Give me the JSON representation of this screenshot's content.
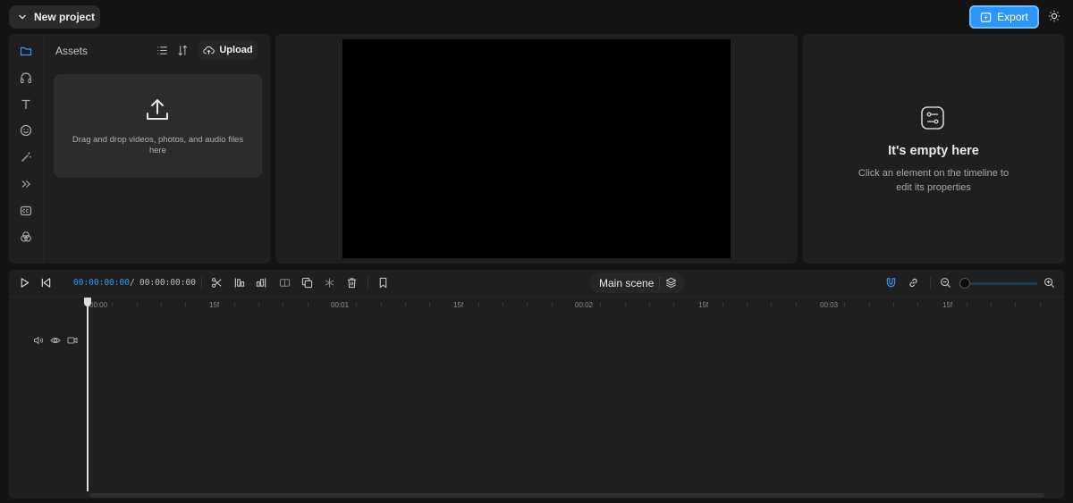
{
  "header": {
    "project_label": "New project",
    "export_label": "Export",
    "icons": [
      "chevron-down-icon",
      "export-icon",
      "sun-icon"
    ]
  },
  "assets_panel": {
    "title": "Assets",
    "upload_label": "Upload",
    "dropzone_text": "Drag and drop videos, photos, and audio files here",
    "rail_icons": [
      "folder-icon",
      "headphones-icon",
      "text-icon",
      "sticker-icon",
      "magic-wand-icon",
      "transitions-icon",
      "captions-icon",
      "filters-icon"
    ]
  },
  "properties_panel": {
    "empty_title": "It's empty here",
    "empty_subtitle": "Click an element on the timeline to edit its properties"
  },
  "timeline": {
    "current_time": "00:00:00:00",
    "separator": "/",
    "total_time": "00:00:00:00",
    "scene_label": "Main scene",
    "ruler_labels": [
      "00:00",
      "15f",
      "00:01",
      "15f",
      "00:02",
      "15f",
      "00:03",
      "15f"
    ],
    "zoom_level": 0
  },
  "colors": {
    "accent": "#2f95f5",
    "background": "#141414",
    "panel": "#1f1f1f",
    "timecode_active": "#3b96f0"
  }
}
